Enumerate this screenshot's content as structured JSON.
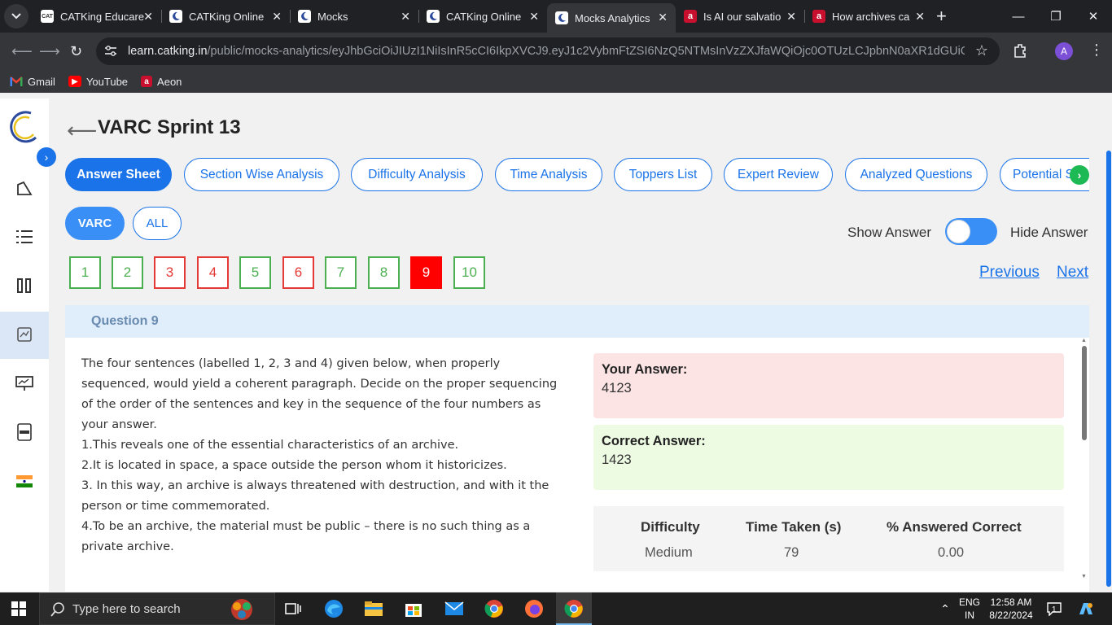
{
  "browser": {
    "tabs": [
      {
        "title": "CATKing Educare",
        "favicon": "catking-icon"
      },
      {
        "title": "CATKing Online",
        "favicon": "moon-icon"
      },
      {
        "title": "Mocks",
        "favicon": "moon-icon"
      },
      {
        "title": "CATKing Online",
        "favicon": "moon-icon"
      },
      {
        "title": "Mocks Analytics",
        "favicon": "moon-icon",
        "active": true
      },
      {
        "title": "Is AI our salvatio",
        "favicon": "aeon-icon"
      },
      {
        "title": "How archives ca",
        "favicon": "aeon-icon"
      }
    ],
    "url_host": "learn.catking.in",
    "url_path": "/public/mocks-analytics/eyJhbGciOiJIUzI1NiIsInR5cCI6IkpXVCJ9.eyJ1c2VybmFtZSI6NzQ5NTMsInVzZXJfaWQiOjc0OTUzLCJpbnN0aXR1dGUiOjE1MDksI...",
    "profile_initial": "A",
    "bookmarks": [
      {
        "label": "Gmail",
        "icon": "gmail-icon"
      },
      {
        "label": "YouTube",
        "icon": "youtube-icon"
      },
      {
        "label": "Aeon",
        "icon": "aeon-icon"
      }
    ]
  },
  "page": {
    "title": "VARC Sprint 13",
    "tabs": [
      "Answer Sheet",
      "Section Wise Analysis",
      "Difficulty Analysis",
      "Time Analysis",
      "Toppers List",
      "Expert Review",
      "Analyzed Questions",
      "Potential S"
    ],
    "active_tab": "Answer Sheet",
    "sections": [
      "VARC",
      "ALL"
    ],
    "active_section": "VARC",
    "show_answer_label": "Show Answer",
    "hide_answer_label": "Hide Answer",
    "questions": [
      {
        "num": "1",
        "status": "correct"
      },
      {
        "num": "2",
        "status": "correct"
      },
      {
        "num": "3",
        "status": "wrong"
      },
      {
        "num": "4",
        "status": "wrong"
      },
      {
        "num": "5",
        "status": "correct"
      },
      {
        "num": "6",
        "status": "wrong"
      },
      {
        "num": "7",
        "status": "correct"
      },
      {
        "num": "8",
        "status": "correct"
      },
      {
        "num": "9",
        "status": "current"
      },
      {
        "num": "10",
        "status": "correct"
      }
    ],
    "previous_label": "Previous",
    "next_label": "Next",
    "question_heading": "Question 9",
    "question_paragraphs": [
      "The four sentences (labelled 1, 2, 3 and 4) given below, when properly sequenced, would yield a coherent paragraph. Decide on the proper sequencing of the order of the sentences and key in the sequence of the four numbers as your answer.",
      "1.This reveals one of the essential characteristics of an archive.",
      "2.It is located in space, a space outside the person whom it historicizes.",
      "3. In this way, an archive is always threatened with destruction, and with it the person or time commemorated.",
      "4.To be an archive, the material must be public – there is no such thing as a private archive."
    ],
    "your_answer_label": "Your Answer:",
    "your_answer": "4123",
    "correct_answer_label": "Correct Answer:",
    "correct_answer": "1423",
    "stats": {
      "headers": [
        "Difficulty",
        "Time Taken (s)",
        "% Answered Correct"
      ],
      "values": [
        "Medium",
        "79",
        "0.00"
      ]
    },
    "colors": {
      "accent": "#1a73e8",
      "correct": "#4caf50",
      "wrong": "#e53935",
      "your_answer_bg": "#fde4e4",
      "correct_answer_bg": "#eefbe3"
    }
  },
  "taskbar": {
    "search_placeholder": "Type here to search",
    "lang_top": "ENG",
    "lang_bottom": "IN",
    "time": "12:58 AM",
    "date": "8/22/2024",
    "notifications": "1"
  }
}
